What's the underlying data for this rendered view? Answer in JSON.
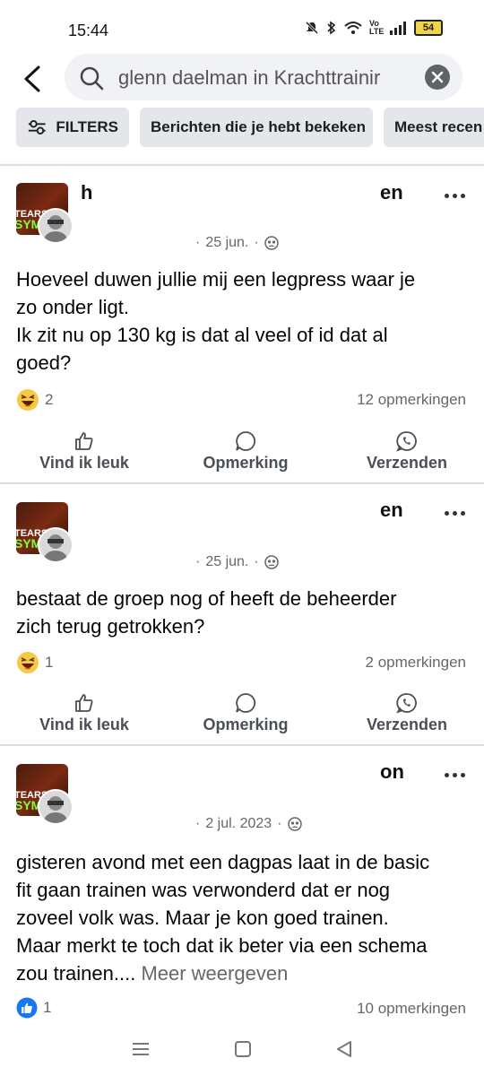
{
  "status_bar": {
    "time": "15:44",
    "network": "Vo LTE",
    "battery": "54"
  },
  "search": {
    "value": "glenn daelman in Krachttrainir"
  },
  "filters": [
    {
      "label": "FILTERS"
    },
    {
      "label": "Berichten die je hebt bekeken"
    },
    {
      "label": "Meest recen"
    }
  ],
  "posts": [
    {
      "name_fragments": [
        "h",
        "en"
      ],
      "date": "25 jun.",
      "text_lines": [
        "Hoeveel duwen jullie mij een legpress waar je",
        "zo onder ligt.",
        "Ik zit nu op 130 kg  is dat al veel of id dat al",
        "goed?"
      ],
      "reaction_count": "2",
      "comments": "12 opmerkingen",
      "reaction": "haha"
    },
    {
      "name_fragments": [
        "en"
      ],
      "date": "25 jun.",
      "text_lines": [
        "bestaat de groep nog of heeft de beheerder",
        "zich terug getrokken?"
      ],
      "reaction_count": "1",
      "comments": "2 opmerkingen",
      "reaction": "haha"
    },
    {
      "name_fragments": [
        "on"
      ],
      "date": "2 jul. 2023",
      "text_lines": [
        "gisteren avond met een dagpas laat in de basic",
        "fit gaan trainen was verwonderd dat er nog",
        "zoveel volk was. Maar je kon goed trainen.",
        "Maar merkt te toch dat ik beter via een schema"
      ],
      "last_line": "zou trainen....",
      "see_more": "Meer weergeven",
      "reaction_count": "1",
      "comments": "10 opmerkingen",
      "reaction": "like"
    }
  ],
  "actions": {
    "like": "Vind ik leuk",
    "comment": "Opmerking",
    "send": "Verzenden"
  },
  "colors": {
    "accent": "#1877f2",
    "chip_bg": "#e4e6eb",
    "search_bg": "#f0f2f5"
  }
}
